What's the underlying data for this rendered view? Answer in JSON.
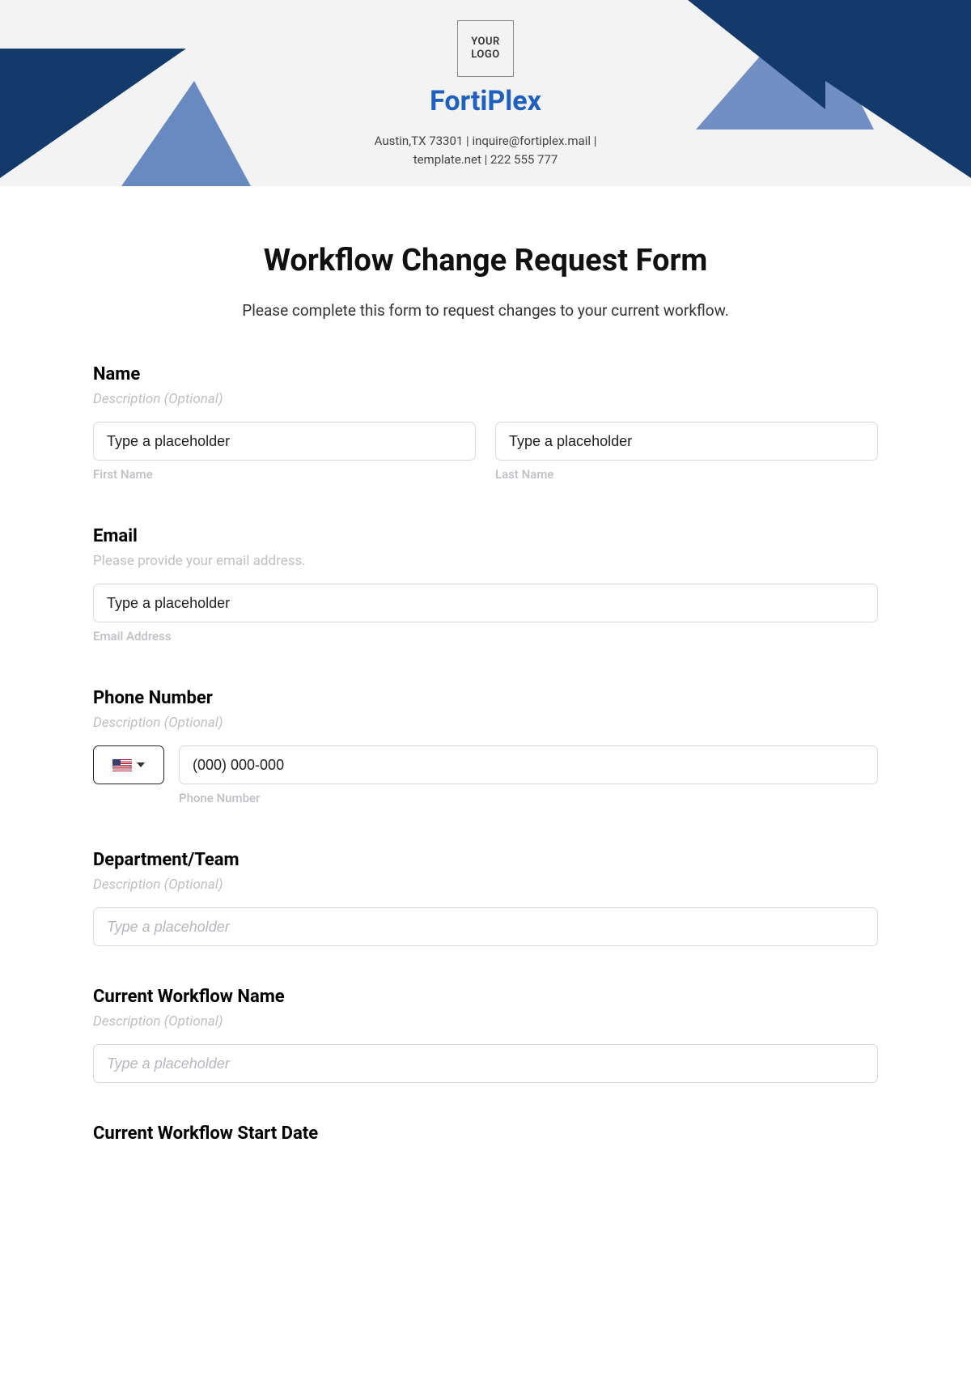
{
  "header": {
    "logo_text": "YOUR\nLOGO",
    "brand": "FortiPlex",
    "contact_line1": "Austin,TX 73301 | inquire@fortiplex.mail |",
    "contact_line2": "template.net | 222 555 777"
  },
  "form": {
    "title": "Workflow Change Request Form",
    "intro": "Please complete this form to request changes to your current workflow.",
    "name": {
      "label": "Name",
      "desc": "Description (Optional)",
      "first_placeholder": "Type a placeholder",
      "first_sub": "First Name",
      "last_placeholder": "Type a placeholder",
      "last_sub": "Last Name"
    },
    "email": {
      "label": "Email",
      "desc": "Please provide your email address.",
      "placeholder": "Type a placeholder",
      "sub": "Email Address"
    },
    "phone": {
      "label": "Phone Number",
      "desc": "Description (Optional)",
      "placeholder": "(000) 000-000",
      "sub": "Phone Number"
    },
    "dept": {
      "label": "Department/Team",
      "desc": "Description (Optional)",
      "placeholder": "Type a placeholder"
    },
    "workflow_name": {
      "label": "Current Workflow Name",
      "desc": "Description (Optional)",
      "placeholder": "Type a placeholder"
    },
    "workflow_start": {
      "label": "Current Workflow Start Date"
    }
  }
}
